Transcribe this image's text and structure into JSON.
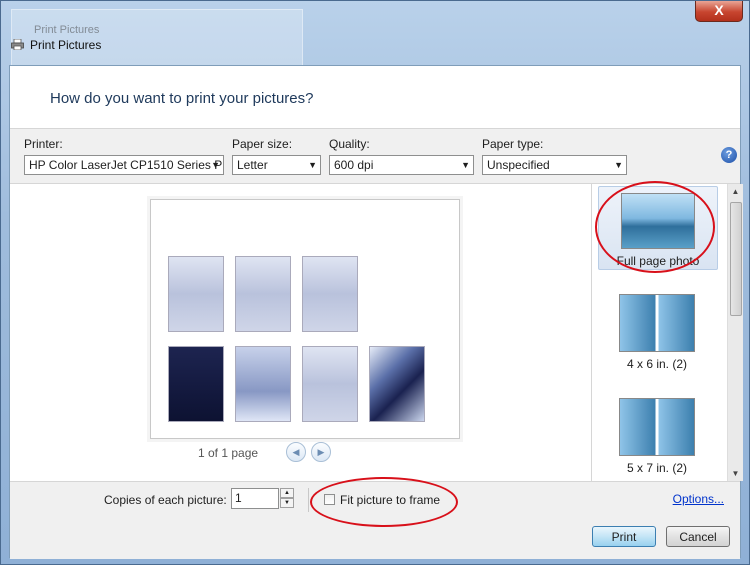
{
  "window": {
    "title": "Print Pictures",
    "close_glyph": "X",
    "background_title": "Print Pictures"
  },
  "heading": "How do you want to print your pictures?",
  "toolbar": {
    "printer": {
      "label": "Printer:",
      "value": "HP Color LaserJet CP1510 Series P"
    },
    "paper_size": {
      "label": "Paper size:",
      "value": "Letter"
    },
    "quality": {
      "label": "Quality:",
      "value": "600 dpi"
    },
    "paper_type": {
      "label": "Paper type:",
      "value": "Unspecified"
    },
    "help_glyph": "?"
  },
  "preview": {
    "pager_text": "1 of 1 page",
    "prev_glyph": "◀",
    "next_glyph": "▶",
    "thumbnails": [
      {
        "name": "photo-1",
        "style": "mix"
      },
      {
        "name": "photo-2",
        "style": "light"
      },
      {
        "name": "photo-3",
        "style": "light"
      },
      {
        "name": "photo-4",
        "style": "dark"
      },
      {
        "name": "photo-5",
        "style": "mix"
      },
      {
        "name": "photo-6",
        "style": "light"
      },
      {
        "name": "photo-7",
        "style": "night"
      }
    ]
  },
  "layouts": [
    {
      "label": "Full page photo",
      "selected": true
    },
    {
      "label": "4 x 6 in. (2)",
      "selected": false
    },
    {
      "label": "5 x 7 in. (2)",
      "selected": false
    }
  ],
  "bottom": {
    "copies_label": "Copies of each picture:",
    "copies_value": "1",
    "fit_label": "Fit picture to frame",
    "fit_checked": false,
    "options_link": "Options..."
  },
  "buttons": {
    "print": "Print",
    "cancel": "Cancel"
  },
  "colors": {
    "accent": "#1e395b",
    "annotation": "#d8101a",
    "link": "#0033cc"
  }
}
